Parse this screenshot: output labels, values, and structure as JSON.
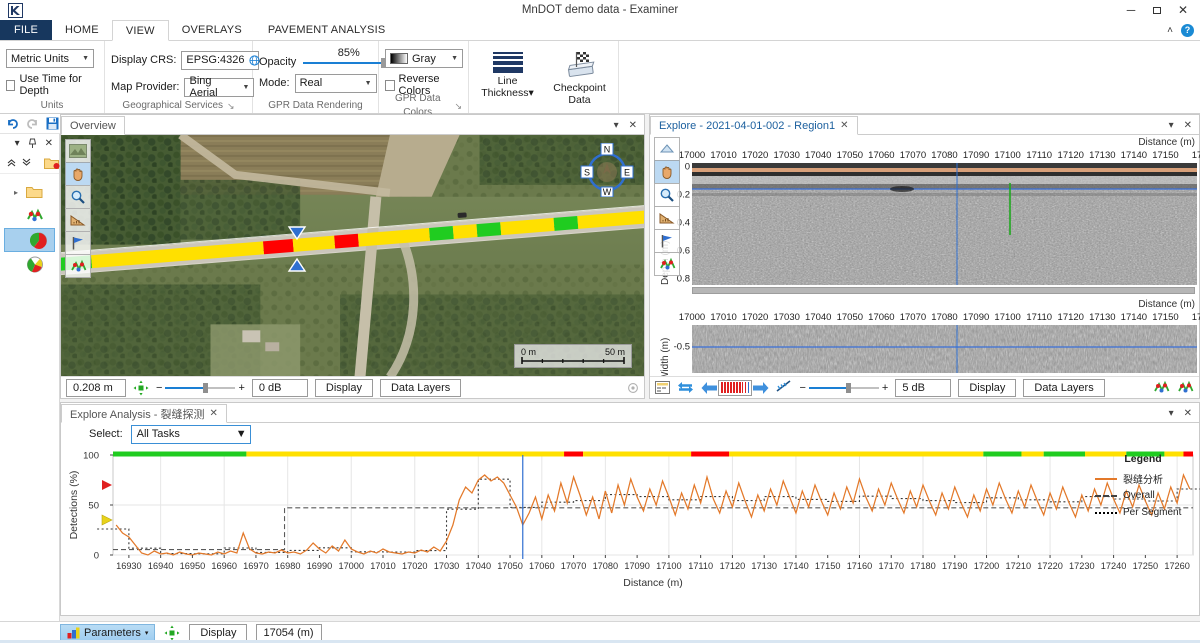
{
  "app": {
    "title": "MnDOT demo data - Examiner",
    "logo_icon": "app-logo-icon",
    "window": {
      "minimize": "─",
      "maximize": "❐",
      "close": "✕",
      "collapse_ribbon": "˄",
      "help": "?"
    }
  },
  "quick_access": {
    "undo_icon": "undo-icon",
    "redo_icon": "redo-icon",
    "save_icon": "save-icon",
    "more": "▾"
  },
  "ribbon": {
    "tabs": [
      {
        "label": "FILE",
        "kind": "file"
      },
      {
        "label": "HOME",
        "kind": "normal"
      },
      {
        "label": "VIEW",
        "kind": "active"
      },
      {
        "label": "OVERLAYS",
        "kind": "normal"
      },
      {
        "label": "PAVEMENT ANALYSIS",
        "kind": "normal"
      }
    ],
    "groups": {
      "units": {
        "label": "Units",
        "unit_system": "Metric Units",
        "use_time_for_depth": "Use Time for Depth",
        "use_time_for_depth_checked": false
      },
      "geo": {
        "label": "Geographical Services",
        "display_crs_label": "Display CRS:",
        "display_crs_value": "EPSG:4326",
        "map_provider_label": "Map Provider:",
        "map_provider_value": "Bing Aerial",
        "dialog_launcher": "↘"
      },
      "rendering": {
        "label": "GPR Data Rendering",
        "opacity_label": "Opacity",
        "opacity_value": "85%",
        "opacity_percent": 85,
        "mode_label": "Mode:",
        "mode_value": "Real"
      },
      "colors": {
        "label": "GPR Data Colors",
        "palette_value": "Gray",
        "reverse_colors": "Reverse Colors",
        "reverse_colors_checked": false,
        "dialog_launcher": "↘"
      },
      "line_thickness": {
        "label_line1": "Line",
        "label_line2": "Thickness",
        "caret": "▾"
      },
      "checkpoint": {
        "label_line1": "Checkpoint",
        "label_line2": "Data"
      }
    }
  },
  "left_dock": {
    "header": {
      "menu": "▾",
      "pin": "📌",
      "close": "✕"
    },
    "collapse_all": "«",
    "expand_all": "»",
    "project_icon": "project-folder-icon",
    "items": [
      {
        "name": "folder-item",
        "icon": "folder-icon",
        "selected": false
      },
      {
        "name": "survey-item",
        "icon": "survey-icon",
        "selected": false
      },
      {
        "name": "analysis-item",
        "icon": "pie-chart-icon",
        "selected": true
      },
      {
        "name": "results-item",
        "icon": "color-wheel-icon",
        "selected": false
      }
    ]
  },
  "overview_panel": {
    "tab_label": "Overview",
    "menu_caret": "▾",
    "close": "✕",
    "map": {
      "tools": [
        {
          "name": "map-thumbnail-tool",
          "icon": "thumbnail-icon",
          "active": false
        },
        {
          "name": "pan-tool",
          "icon": "hand-icon",
          "active": true
        },
        {
          "name": "zoom-tool",
          "icon": "magnifier-icon",
          "active": false
        },
        {
          "name": "measure-tool",
          "icon": "ruler-icon",
          "active": false
        },
        {
          "name": "flag-tool",
          "icon": "flag-icon",
          "active": false
        },
        {
          "name": "markers-tool",
          "icon": "markers-icon",
          "active": false
        }
      ],
      "compass": {
        "n": "N",
        "e": "E",
        "s": "S",
        "w": "W"
      },
      "scale_min": "0 m",
      "scale_max": "50 m"
    },
    "footer": {
      "resolution": "0.208 m",
      "center_icon": "center-crosshair-icon",
      "gain_minus": "−",
      "gain_plus": "+",
      "gain_value": "0 dB",
      "display_button": "Display",
      "data_layers_button": "Data Layers",
      "settings_icon": "settings-icon"
    }
  },
  "explore_panel": {
    "tab_label": "Explore - 2021-04-01-002 - Region1",
    "tab_close": "✕",
    "menu_caret": "▾",
    "close": "✕",
    "tools": [
      {
        "name": "collapse-tool",
        "icon": "up-arrow-icon",
        "active": false
      },
      {
        "name": "pan-tool",
        "icon": "hand-icon",
        "active": true
      },
      {
        "name": "zoom-tool",
        "icon": "magnifier-icon",
        "active": false
      },
      {
        "name": "layer-pick-tool",
        "icon": "ruler-icon",
        "active": false
      },
      {
        "name": "flag-tool",
        "icon": "flag-icon",
        "active": false
      },
      {
        "name": "markers-tool",
        "icon": "markers-icon",
        "active": false
      }
    ],
    "top_chart": {
      "x_axis_title": "Distance (m)",
      "y_axis_title": "Depth (m)",
      "x_ticks": [
        "17000",
        "17010",
        "17020",
        "17030",
        "17040",
        "17050",
        "17060",
        "17070",
        "17080",
        "17090",
        "17100",
        "17110",
        "17120",
        "17130",
        "17140",
        "17150",
        "17"
      ],
      "y_ticks": [
        "0",
        "0.2",
        "0.4",
        "0.6",
        "0.8"
      ]
    },
    "bottom_chart": {
      "x_axis_title": "Distance (m)",
      "y_axis_title": "Width (m)",
      "x_ticks": [
        "17000",
        "17010",
        "17020",
        "17030",
        "17040",
        "17050",
        "17060",
        "17070",
        "17080",
        "17090",
        "17100",
        "17110",
        "17120",
        "17130",
        "17140",
        "17150",
        "17"
      ],
      "y_ticks": [
        "-0.5"
      ]
    },
    "footer": {
      "grid_icon": "grid-view-icon",
      "swap_icon": "swap-vertical-icon",
      "prev_icon": "arrow-left-icon",
      "next_icon": "arrow-right-icon",
      "traces_icon": "trace-ticks-icon",
      "wave_icon": "wave-tool-icon",
      "gain_minus": "−",
      "gain_plus": "+",
      "gain_value": "5 dB",
      "display_button": "Display",
      "data_layers_button": "Data Layers",
      "markers_icon_1": "markers-icon",
      "markers_icon_2": "markers-icon"
    }
  },
  "analysis_panel": {
    "tab_label": "Explore Analysis - 裂缝探测",
    "tab_close": "✕",
    "menu_caret": "▾",
    "close": "✕",
    "select_label": "Select:",
    "select_value": "All Tasks",
    "footer": {
      "parameters_button": "Parameters",
      "parameters_caret": "▾",
      "parameters_icon": "parameters-icon",
      "center_icon": "center-crosshair-icon",
      "display_button": "Display",
      "position_value": "17054 (m)"
    }
  },
  "chart_data": {
    "type": "line",
    "title": "",
    "xlabel": "Distance (m)",
    "ylabel": "Detections (%)",
    "xlim": [
      16925,
      17265
    ],
    "ylim": [
      0,
      100
    ],
    "y_ticks": [
      0,
      50,
      100
    ],
    "x_ticks": [
      16930,
      16940,
      16950,
      16960,
      16970,
      16980,
      16990,
      17000,
      17010,
      17020,
      17030,
      17040,
      17050,
      17060,
      17070,
      17080,
      17090,
      17100,
      17110,
      17120,
      17130,
      17140,
      17150,
      17160,
      17170,
      17180,
      17190,
      17200,
      17210,
      17220,
      17230,
      17240,
      17250,
      17260
    ],
    "grid": true,
    "legend": {
      "position": "top-right",
      "title": "Legend",
      "entries": [
        {
          "label": "裂缝分析",
          "color": "#e3792a",
          "style": "solid"
        },
        {
          "label": "Overall",
          "color": "#404040",
          "style": "dashed"
        },
        {
          "label": "Per Segment",
          "color": "#000000",
          "style": "dotted"
        }
      ]
    },
    "markers": {
      "red_threshold": {
        "value": 70,
        "color": "#e02020",
        "name": "red-threshold-marker"
      },
      "yellow_threshold": {
        "value": 35,
        "color": "#e8d21a",
        "name": "yellow-threshold-marker"
      },
      "cursor_position": 17054,
      "cursor_color": "#2f6fd0"
    },
    "series": [
      {
        "name": "裂缝分析",
        "color": "#e3792a",
        "style": "solid",
        "x": [
          16926,
          16928,
          16930,
          16932,
          16934,
          16936,
          16938,
          16940,
          16942,
          16944,
          16946,
          16948,
          16950,
          16952,
          16954,
          16956,
          16958,
          16960,
          16962,
          16964,
          16966,
          16968,
          16970,
          16972,
          16974,
          16976,
          16978,
          16980,
          16982,
          16984,
          16986,
          16988,
          16990,
          16992,
          16994,
          16996,
          16998,
          17000,
          17002,
          17004,
          17006,
          17008,
          17010,
          17012,
          17014,
          17016,
          17018,
          17020,
          17022,
          17024,
          17026,
          17028,
          17030,
          17032,
          17034,
          17036,
          17038,
          17040,
          17042,
          17044,
          17046,
          17048,
          17050,
          17052,
          17054,
          17056,
          17058,
          17060,
          17062,
          17064,
          17066,
          17068,
          17070,
          17072,
          17074,
          17076,
          17078,
          17080,
          17082,
          17084,
          17086,
          17088,
          17090,
          17092,
          17094,
          17096,
          17098,
          17100,
          17102,
          17104,
          17106,
          17108,
          17110,
          17112,
          17114,
          17116,
          17118,
          17120,
          17122,
          17124,
          17126,
          17128,
          17130,
          17132,
          17134,
          17136,
          17138,
          17140,
          17142,
          17144,
          17146,
          17148,
          17150,
          17152,
          17154,
          17156,
          17158,
          17160,
          17162,
          17164,
          17166,
          17168,
          17170,
          17172,
          17174,
          17176,
          17178,
          17180,
          17182,
          17184,
          17186,
          17188,
          17190,
          17192,
          17194,
          17196,
          17198,
          17200,
          17202,
          17204,
          17206,
          17208,
          17210,
          17212,
          17214,
          17216,
          17218,
          17220,
          17222,
          17224,
          17226,
          17228,
          17230,
          17232,
          17234,
          17236,
          17238,
          17240,
          17242,
          17244,
          17246,
          17248,
          17250,
          17252,
          17254,
          17256,
          17258,
          17260,
          17262,
          17264
        ],
        "y": [
          30,
          22,
          18,
          10,
          2,
          0,
          4,
          1,
          2,
          0,
          3,
          1,
          0,
          2,
          1,
          0,
          3,
          1,
          4,
          2,
          22,
          6,
          2,
          1,
          3,
          2,
          5,
          2,
          3,
          1,
          5,
          12,
          6,
          2,
          9,
          4,
          15,
          6,
          3,
          1,
          4,
          2,
          6,
          3,
          2,
          1,
          3,
          2,
          5,
          3,
          8,
          4,
          14,
          30,
          55,
          68,
          62,
          75,
          80,
          74,
          78,
          72,
          60,
          48,
          30,
          42,
          58,
          36,
          60,
          44,
          72,
          52,
          78,
          60,
          40,
          58,
          36,
          64,
          42,
          70,
          50,
          76,
          58,
          44,
          66,
          50,
          74,
          58,
          40,
          62,
          46,
          70,
          52,
          78,
          56,
          42,
          64,
          48,
          72,
          54,
          38,
          60,
          44,
          66,
          50,
          74,
          58,
          42,
          64,
          48,
          70,
          54,
          40,
          62,
          46,
          68,
          52,
          76,
          58,
          44,
          66,
          50,
          72,
          56,
          42,
          64,
          48,
          70,
          54,
          40,
          62,
          46,
          68,
          52,
          38,
          60,
          44,
          66,
          50,
          72,
          56,
          42,
          64,
          48,
          70,
          54,
          40,
          62,
          46,
          68,
          52,
          38,
          60,
          44,
          66,
          50,
          72,
          56,
          42,
          64,
          48,
          70,
          54,
          40,
          62,
          46,
          68,
          52,
          80,
          66,
          90
        ]
      },
      {
        "name": "Overall",
        "color": "#4a4a4a",
        "style": "dashed",
        "note": "flat reference line at approx 15% for first segment, stepping to ~65% after 16979"
      },
      {
        "name": "Per Segment",
        "color": "#2b2b2b",
        "style": "dotted",
        "note": "piecewise-constant per-segment averages following the orange trace"
      }
    ],
    "condition_bar": {
      "name": "segment-condition-bar",
      "y_position": 100,
      "segments": [
        {
          "from": 16925,
          "to": 16967,
          "color": "#20cc20"
        },
        {
          "from": 16967,
          "to": 17067,
          "color": "#ffe000"
        },
        {
          "from": 17067,
          "to": 17073,
          "color": "#ff0000"
        },
        {
          "from": 17073,
          "to": 17107,
          "color": "#ffe000"
        },
        {
          "from": 17107,
          "to": 17119,
          "color": "#ff0000"
        },
        {
          "from": 17119,
          "to": 17199,
          "color": "#ffe000"
        },
        {
          "from": 17199,
          "to": 17211,
          "color": "#20cc20"
        },
        {
          "from": 17211,
          "to": 17218,
          "color": "#ffe000"
        },
        {
          "from": 17218,
          "to": 17231,
          "color": "#20cc20"
        },
        {
          "from": 17231,
          "to": 17244,
          "color": "#ffe000"
        },
        {
          "from": 17244,
          "to": 17256,
          "color": "#20cc20"
        },
        {
          "from": 17256,
          "to": 17262,
          "color": "#ffe000"
        },
        {
          "from": 17262,
          "to": 17265,
          "color": "#ff0000"
        }
      ]
    }
  },
  "map_overlay": {
    "road_segments": [
      {
        "start": 0.0,
        "end": 0.06,
        "color": "#20cc20"
      },
      {
        "start": 0.06,
        "end": 0.35,
        "color": "#ffe000"
      },
      {
        "start": 0.35,
        "end": 0.4,
        "color": "#ff0000"
      },
      {
        "start": 0.4,
        "end": 0.47,
        "color": "#ffe000"
      },
      {
        "start": 0.47,
        "end": 0.51,
        "color": "#ff0000"
      },
      {
        "start": 0.51,
        "end": 0.63,
        "color": "#ffe000"
      },
      {
        "start": 0.63,
        "end": 0.67,
        "color": "#20cc20"
      },
      {
        "start": 0.67,
        "end": 0.71,
        "color": "#ffe000"
      },
      {
        "start": 0.71,
        "end": 0.75,
        "color": "#20cc20"
      },
      {
        "start": 0.75,
        "end": 0.84,
        "color": "#ffe000"
      },
      {
        "start": 0.84,
        "end": 0.88,
        "color": "#20cc20"
      },
      {
        "start": 0.88,
        "end": 1.0,
        "color": "#ffe000"
      }
    ],
    "cursor_marker": {
      "name": "map-position-marker",
      "color": "#2f6fd0",
      "position": 0.38
    }
  },
  "colors": {
    "accent": "#1a7fd4",
    "file_tab": "#17375e",
    "good": "#20cc20",
    "warn": "#ffe000",
    "bad": "#ff0000",
    "series": "#e3792a"
  }
}
